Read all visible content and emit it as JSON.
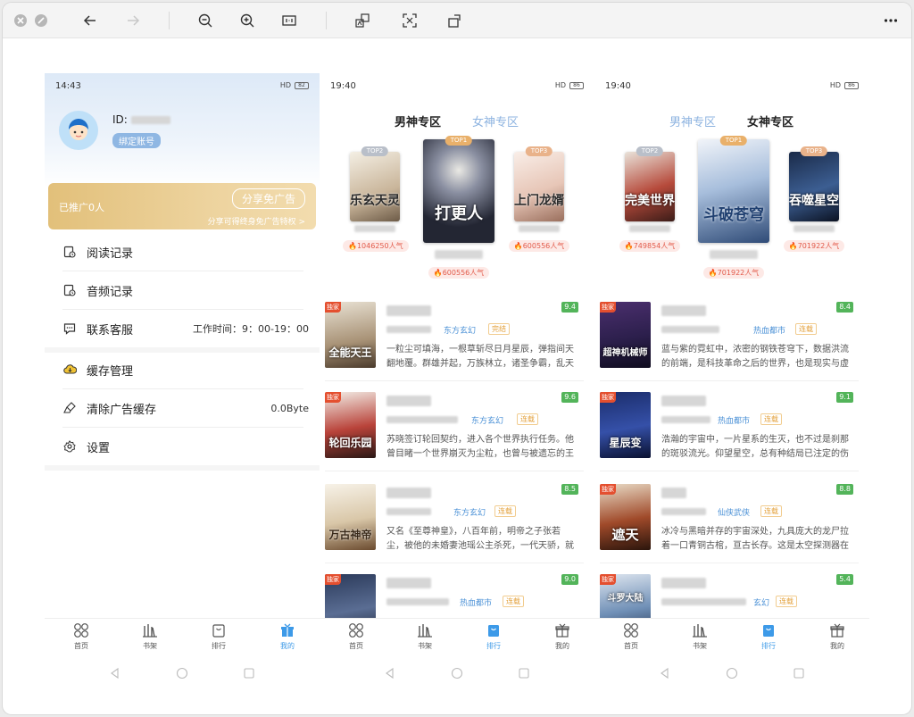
{
  "toolbar": {
    "icons": [
      "close-icon",
      "minimize-icon",
      "back-arrow-icon",
      "forward-arrow-icon",
      "zoom-out-icon",
      "zoom-in-icon",
      "fit-page-icon",
      "translate-icon",
      "scan-icon",
      "rotate-icon",
      "more-icon"
    ]
  },
  "profile": {
    "status_time": "14:43",
    "status_right": "HD",
    "battery": "82",
    "id_label": "ID:",
    "bind_button": "绑定账号",
    "promo": {
      "left": "已推广0人",
      "button": "分享免广告",
      "sub": "分享可得终身免广告特权 >"
    },
    "menu": [
      {
        "label": "阅读记录",
        "right": "",
        "icon": "reading-history-icon"
      },
      {
        "label": "音频记录",
        "right": "",
        "icon": "audio-history-icon"
      },
      {
        "label": "联系客服",
        "right": "工作时间：9：00-19：00",
        "icon": "customer-service-icon"
      },
      {
        "label": "缓存管理",
        "right": "",
        "icon": "cache-icon"
      },
      {
        "label": "清除广告缓存",
        "right": "0.0Byte",
        "icon": "clear-ad-icon"
      },
      {
        "label": "设置",
        "right": "",
        "icon": "settings-icon"
      }
    ]
  },
  "tabs": {
    "home": "首页",
    "shelf": "书架",
    "rank": "排行",
    "mine": "我的"
  },
  "rank_male": {
    "status_time": "19:40",
    "status_right": "HD",
    "battery": "86",
    "tab_male": "男神专区",
    "tab_female": "女神专区",
    "top": [
      {
        "rank": "TOP2",
        "title": "乐玄天灵",
        "popularity": "1046250人气"
      },
      {
        "rank": "TOP1",
        "title": "打更人",
        "popularity": "600556人气"
      },
      {
        "rank": "TOP3",
        "title": "上门龙婿",
        "popularity": "600556人气"
      }
    ],
    "list": [
      {
        "cover": "全能天王",
        "badge": "独家",
        "category": "东方玄幻",
        "status": "完结",
        "score": "9.4",
        "desc": "一粒尘可填海，一根草斩尽日月星辰，弹指间天翻地覆。群雄并起，万族林立，诸圣争霸，乱天动..."
      },
      {
        "cover": "轮回乐园",
        "badge": "独家",
        "category": "东方玄幻",
        "status": "连载",
        "score": "9.6",
        "desc": "苏晓签订轮回契约，进入各个世界执行任务。他曾目睹一个世界崩灭为尘粒，也曾与被遗忘的王者..."
      },
      {
        "cover": "万古神帝",
        "badge": "",
        "category": "东方玄幻",
        "status": "连载",
        "score": "8.5",
        "desc": "又名《至尊神皇》，八百年前，明帝之子张若尘，被他的未婚妻池瑶公主杀死，一代天骄，就此陨..."
      },
      {
        "cover": "",
        "badge": "独家",
        "category": "热血都市",
        "status": "连载",
        "score": "9.0",
        "desc": ""
      }
    ]
  },
  "rank_female": {
    "status_time": "19:40",
    "status_right": "HD",
    "battery": "86",
    "tab_male": "男神专区",
    "tab_female": "女神专区",
    "top": [
      {
        "rank": "TOP2",
        "title": "完美世界",
        "popularity": "749854人气"
      },
      {
        "rank": "TOP1",
        "title": "斗破苍穹",
        "popularity": "701922人气"
      },
      {
        "rank": "TOP3",
        "title": "吞噬星空",
        "popularity": "701922人气"
      }
    ],
    "list": [
      {
        "cover": "超神机械师",
        "badge": "独家",
        "category": "热血都市",
        "status": "连载",
        "score": "8.4",
        "desc": "蓝与紫的霓虹中，浓密的钢铁苍穹下，数据洪流的前端，是科技革命之后的世界，也是现实与虚幻..."
      },
      {
        "cover": "星辰变",
        "badge": "独家",
        "category": "热血都市",
        "status": "连载",
        "score": "9.1",
        "desc": "浩瀚的宇宙中，一片星系的生灭，也不过是刹那的斑驳流光。仰望星空，总有种结局已注定的伤感..."
      },
      {
        "cover": "遮天",
        "badge": "独家",
        "category": "仙侠武侠",
        "status": "连载",
        "score": "8.8",
        "desc": "冰冷与黑暗并存的宇宙深处，九具庞大的龙尸拉着一口青铜古棺，亘古长存。这是太空探测器在枯..."
      },
      {
        "cover": "斗罗大陆",
        "badge": "独家",
        "category": "玄幻",
        "status": "连载",
        "score": "5.4",
        "desc": ""
      }
    ]
  },
  "colors": {
    "accent": "#3d9ae8",
    "female_accent": "#8db3e0",
    "score": "#53b45a",
    "hot": "#e25a4a",
    "gold": "#e2c07a"
  }
}
